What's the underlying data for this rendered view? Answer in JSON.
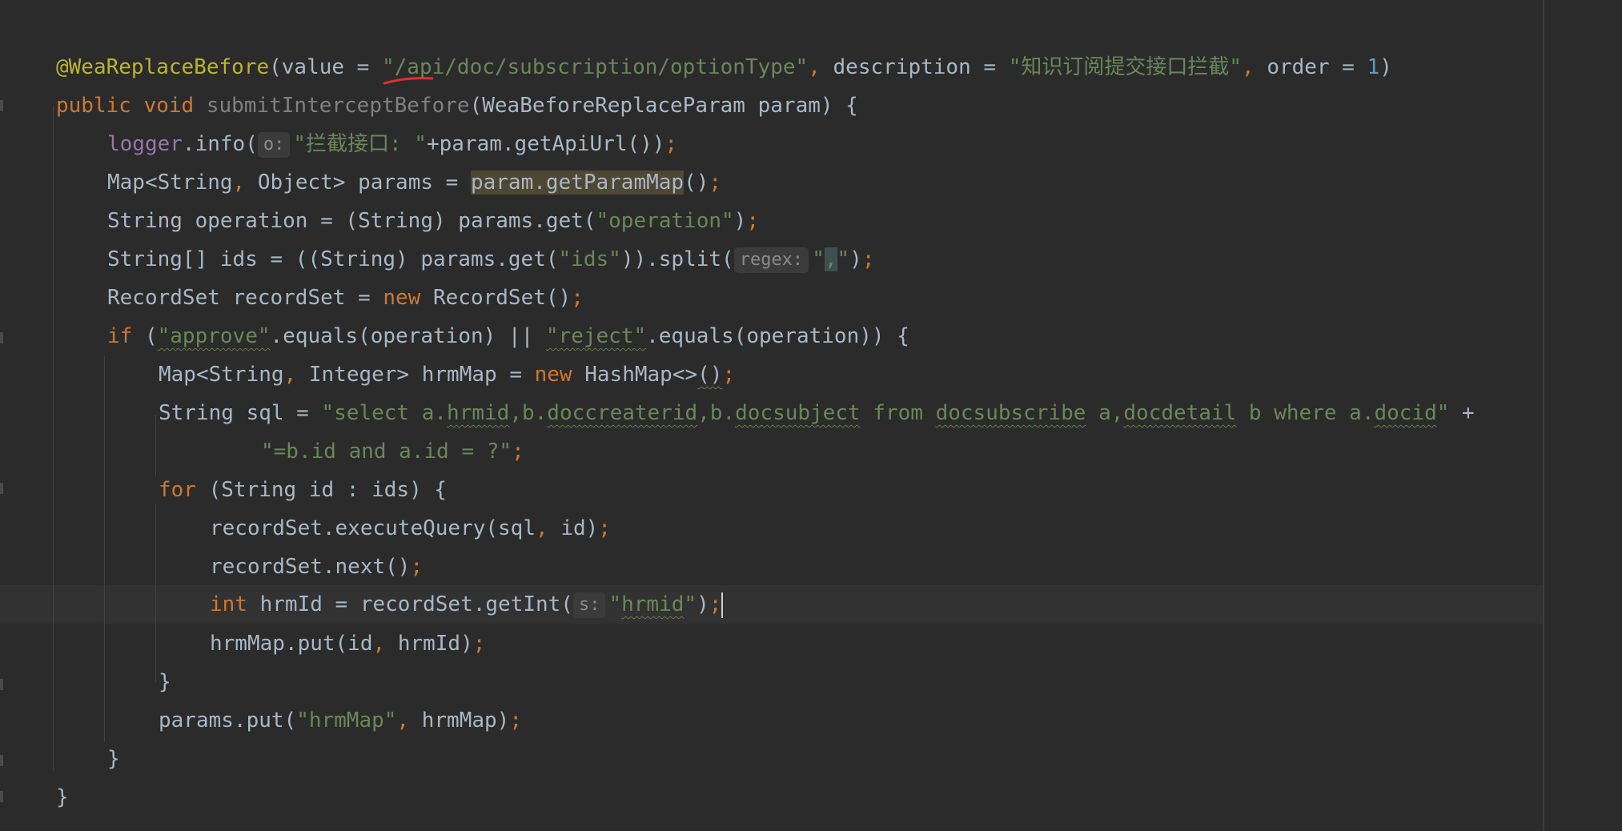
{
  "editor": {
    "language": "Java",
    "caret_line": 15,
    "colors": {
      "background": "#2b2b2b",
      "keyword": "#cc7832",
      "string": "#6a8759",
      "annotation": "#bbb529",
      "number": "#6897bb",
      "field": "#9876aa",
      "default_text": "#a9b7c6"
    }
  },
  "hints": {
    "o": "o:",
    "regex": "regex:",
    "s": "s:"
  },
  "code": {
    "l1": {
      "ann": "@WeaReplaceBefore",
      "p1": "(value = ",
      "s1": "\"/api/doc/subscription/optionType\"",
      "p2": ", ",
      "p3": "description = ",
      "s2": "\"知识订阅提交接口拦截\"",
      "p4": ", ",
      "p5": "order = ",
      "n1": "1",
      "p6": ")"
    },
    "l2": {
      "kw1": "public void ",
      "m": "submitInterceptBefore",
      "p1": "(WeaBeforeReplaceParam param) {"
    },
    "l3": {
      "f": "logger",
      "p1": ".info(",
      "s1": "\"拦截接口: \"",
      "p2": "+param.getApiUrl())",
      "sc": ";"
    },
    "l4": {
      "p1": "Map<String",
      "c1": ", ",
      "p2": "Object> params = ",
      "h": "param.getParamMap",
      "p3": "()",
      "sc": ";"
    },
    "l5": {
      "p1": "String operation = (String) params.get(",
      "s1": "\"operation\"",
      "p2": ")",
      "sc": ";"
    },
    "l6": {
      "p1": "String[] ids = ((String) params.get(",
      "s1": "\"ids\"",
      "p2": ")).split(",
      "s2a": "\"",
      "s2b": ",",
      "s2c": "\"",
      "p3": ")",
      "sc": ";"
    },
    "l7": {
      "p1": "RecordSet recordSet = ",
      "kw": "new ",
      "p2": "RecordSet()",
      "sc": ";"
    },
    "l8": {
      "kw": "if ",
      "p1": "(",
      "s1": "\"approve\"",
      "p2": ".equals(operation) || ",
      "s2": "\"reject\"",
      "p3": ".equals(operation)) {"
    },
    "l9": {
      "p1": "Map<String",
      "c1": ", ",
      "p2": "Integer> hrmMap = ",
      "kw": "new ",
      "p3": "HashMap<>",
      "b": "()",
      "sc": ";"
    },
    "l10": {
      "p1": "String sql = ",
      "s_a": "\"select a.",
      "s_b": "hrmid",
      "s_c": ",b.",
      "s_d": "doccreaterid",
      "s_e": ",b.",
      "s_f": "docsubject",
      "s_g": " from ",
      "s_h": "docsubscribe",
      "s_i": " a,",
      "s_j": "docdetail",
      "s_k": " b where a.",
      "s_l": "docid",
      "s_m": "\"",
      "p2": " +"
    },
    "l11": {
      "s1": "\"=b.id and a.id = ?\"",
      "sc": ";"
    },
    "l12": {
      "kw": "for ",
      "p1": "(String id : ids) {"
    },
    "l13": {
      "p1": "recordSet.executeQuery(sql",
      "c1": ", ",
      "p2": "id)",
      "sc": ";"
    },
    "l14": {
      "p1": "recordSet.next()",
      "sc": ";"
    },
    "l15": {
      "kw": "int ",
      "p1": "hrmId = recordSet.getInt(",
      "s_a": "\"",
      "s_b": "hrmid",
      "s_c": "\"",
      "p2": ")",
      "sc": ";"
    },
    "l16": {
      "p1": "hrmMap.put(id",
      "c1": ", ",
      "p2": "hrmId)",
      "sc": ";"
    },
    "l17": {
      "p1": "}"
    },
    "l18": {
      "p1": "params.put(",
      "s1": "\"hrmMap\"",
      "c1": ", ",
      "p2": "hrmMap)",
      "sc": ";"
    },
    "l19": {
      "p1": "}"
    },
    "l20": {
      "p1": "}"
    }
  }
}
